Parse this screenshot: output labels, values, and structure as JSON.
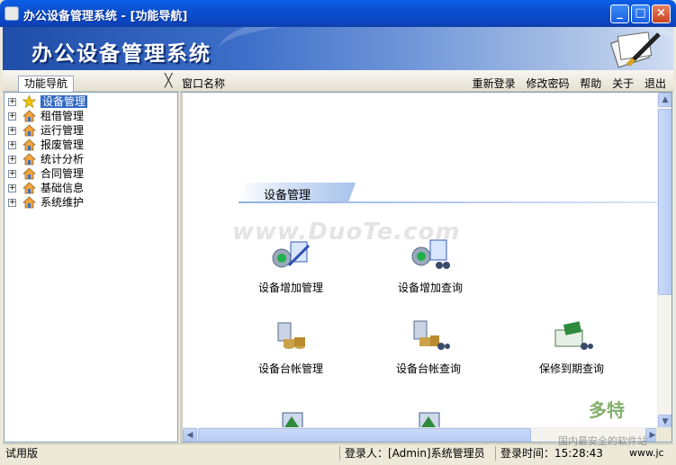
{
  "window": {
    "title": "办公设备管理系统 - [功能导航]",
    "buttons": {
      "minimize": "_",
      "maximize": "□",
      "close": "×"
    }
  },
  "banner": {
    "heading": "办公设备管理系统"
  },
  "toolbar": {
    "nav_tab": "功能导航",
    "nav_close": "╳",
    "window_name_label": "窗口名称",
    "links": [
      "重新登录",
      "修改密码",
      "帮助",
      "关于",
      "退出"
    ]
  },
  "tree": {
    "items": [
      {
        "label": "设备管理",
        "icon": "star-icon",
        "selected": true
      },
      {
        "label": "租借管理",
        "icon": "house-icon"
      },
      {
        "label": "运行管理",
        "icon": "house-icon"
      },
      {
        "label": "报废管理",
        "icon": "house-icon"
      },
      {
        "label": "统计分析",
        "icon": "house-icon"
      },
      {
        "label": "合同管理",
        "icon": "house-icon"
      },
      {
        "label": "基础信息",
        "icon": "house-icon"
      },
      {
        "label": "系统维护",
        "icon": "house-icon"
      }
    ]
  },
  "main": {
    "section_title": "设备管理",
    "watermark": "www.DuoTe.com",
    "functions": [
      {
        "label": "设备增加管理",
        "icon": "equipment-add-icon"
      },
      {
        "label": "设备增加查询",
        "icon": "equipment-query-icon"
      },
      {
        "label": "设备台帐管理",
        "icon": "ledger-manage-icon"
      },
      {
        "label": "设备台帐查询",
        "icon": "ledger-query-icon"
      },
      {
        "label": "保修到期查询",
        "icon": "warranty-query-icon"
      }
    ]
  },
  "statusbar": {
    "mode": "试用版",
    "user": "登录人：[Admin]系统管理员",
    "login_time": "登录时间：15:28:43",
    "site": "www.jc"
  },
  "corner_logo": {
    "big": "多特",
    "small": "国内最安全的软件站"
  },
  "colors": {
    "titlebar": "#0a5fe6",
    "selection": "#316ac5",
    "banner": "#3c6ec8"
  }
}
